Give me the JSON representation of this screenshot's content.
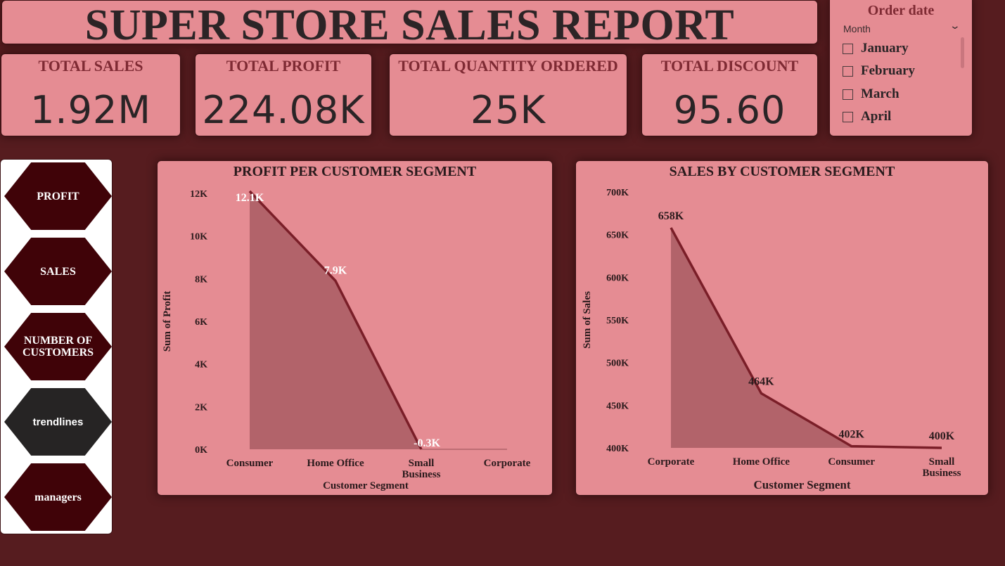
{
  "report_title": "SUPER STORE SALES REPORT",
  "kpis": [
    {
      "label": "TOTAL SALES",
      "value": "1.92M"
    },
    {
      "label": "TOTAL PROFIT",
      "value": "224.08K"
    },
    {
      "label": "TOTAL QUANTITY ORDERED",
      "value": "25K"
    },
    {
      "label": "TOTAL DISCOUNT",
      "value": "95.60"
    }
  ],
  "slicer": {
    "title": "Order date",
    "subtitle": "Month",
    "icon": "chevron-down-icon",
    "items": [
      "January",
      "February",
      "March",
      "April"
    ]
  },
  "nav": [
    {
      "label": "PROFIT"
    },
    {
      "label": "SALES"
    },
    {
      "label": "NUMBER OF CUSTOMERS"
    },
    {
      "label": "trendlines"
    },
    {
      "label": "managers"
    }
  ],
  "colors": {
    "background": "#561c1f",
    "card": "#e58c93",
    "line": "#7a1e28",
    "area": "#b2636a",
    "nav_button": "#400308",
    "nav_button_dark": "#262424"
  },
  "chart_data": [
    {
      "type": "area",
      "title": "PROFIT PER CUSTOMER SEGMENT",
      "xlabel": "Customer Segment",
      "ylabel": "Sum of Profit",
      "categories": [
        "Consumer",
        "Home Office",
        "Small Business",
        "Corporate"
      ],
      "values": [
        12100,
        7900,
        -300,
        null
      ],
      "data_labels": [
        "12.1K",
        "7.9K",
        "-0.3K",
        ""
      ],
      "ylim": [
        0,
        12000
      ],
      "yticks": [
        0,
        2000,
        4000,
        6000,
        8000,
        10000,
        12000
      ],
      "ytick_labels": [
        "0K",
        "2K",
        "4K",
        "6K",
        "8K",
        "10K",
        "12K"
      ],
      "grid": false,
      "legend": "none"
    },
    {
      "type": "area",
      "title": "SALES BY CUSTOMER SEGMENT",
      "xlabel": "Customer Segment",
      "ylabel": "Sum of Sales",
      "categories": [
        "Corporate",
        "Home Office",
        "Consumer",
        "Small Business"
      ],
      "values": [
        658000,
        464000,
        402000,
        400000
      ],
      "data_labels": [
        "658K",
        "464K",
        "402K",
        "400K"
      ],
      "ylim": [
        400000,
        700000
      ],
      "yticks": [
        400000,
        450000,
        500000,
        550000,
        600000,
        650000,
        700000
      ],
      "ytick_labels": [
        "400K",
        "450K",
        "500K",
        "550K",
        "600K",
        "650K",
        "700K"
      ],
      "grid": false,
      "legend": "none"
    }
  ]
}
